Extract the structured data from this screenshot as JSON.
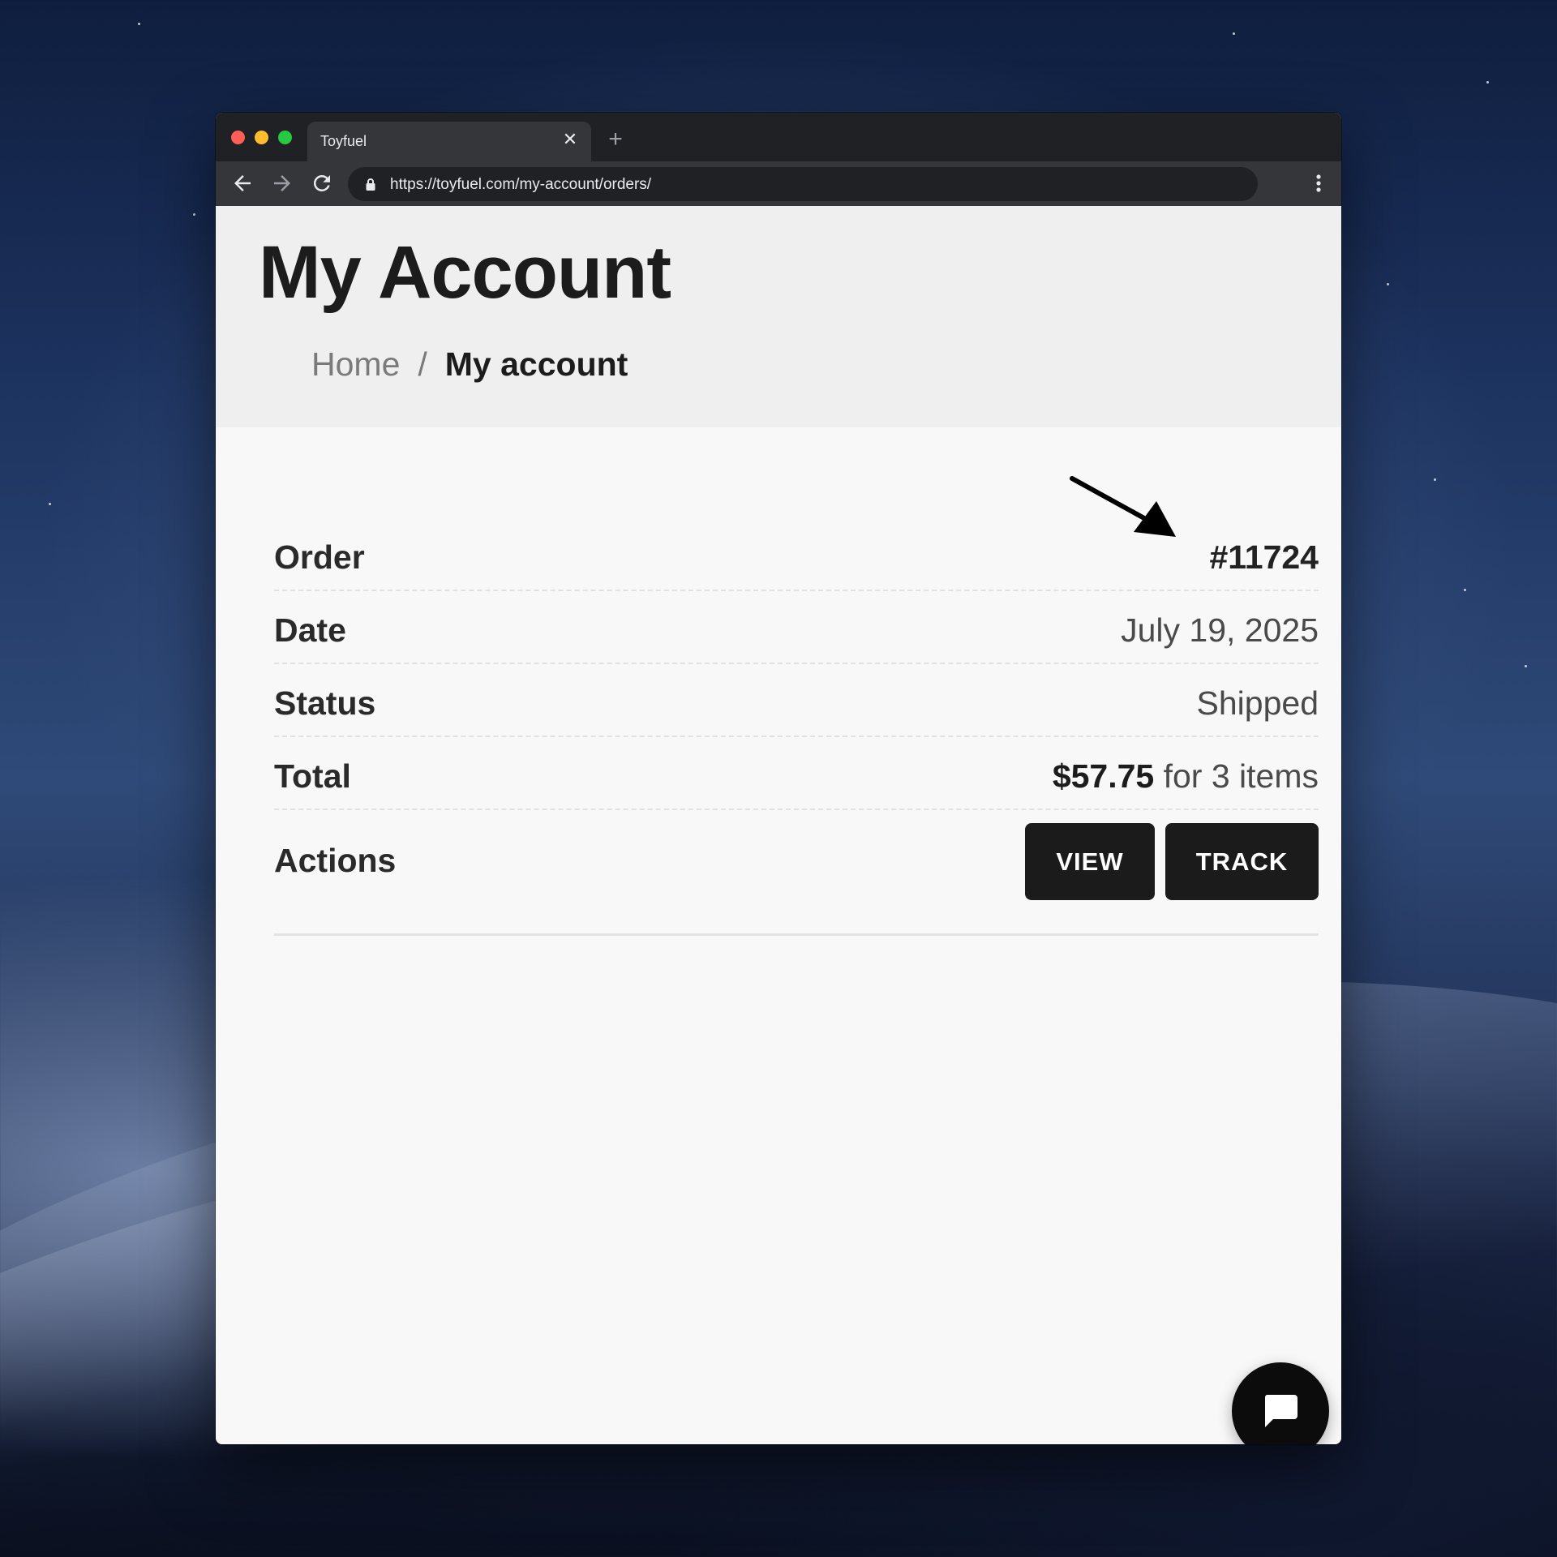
{
  "browser": {
    "tab_title": "Toyfuel",
    "tab_close": "✕",
    "new_tab": "+",
    "url": "https://toyfuel.com/my-account/orders/"
  },
  "page": {
    "title": "My Account",
    "breadcrumb": {
      "home": "Home",
      "separator": "/",
      "current": "My account"
    }
  },
  "order": {
    "rows": [
      {
        "label": "Order",
        "value": "#11724"
      },
      {
        "label": "Date",
        "value": "July 19, 2025"
      },
      {
        "label": "Status",
        "value": "Shipped"
      }
    ],
    "total": {
      "label": "Total",
      "amount": "$57.75",
      "suffix": " for 3 items"
    },
    "actions": {
      "label": "Actions",
      "view_label": "VIEW",
      "track_label": "TRACK"
    }
  },
  "colors": {
    "button_bg": "#1b1b1b",
    "hero_bg": "#efefef",
    "page_bg": "#f8f8f8"
  },
  "icons": [
    "back-arrow-icon",
    "forward-arrow-icon",
    "reload-icon",
    "lock-icon",
    "more-vert-icon",
    "chat-icon",
    "annotation-arrow"
  ]
}
